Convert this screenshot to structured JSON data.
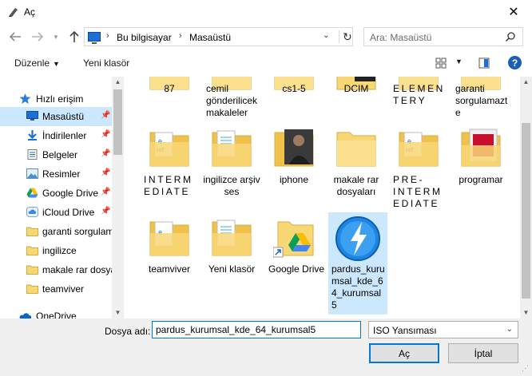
{
  "window": {
    "title": "Aç"
  },
  "address": {
    "segments": [
      "Bu bilgisayar",
      "Masaüstü"
    ]
  },
  "search": {
    "placeholder": "Ara: Masaüstü"
  },
  "toolbar": {
    "organize_label": "Düzenle",
    "new_folder_label": "Yeni klasör"
  },
  "sidebar": {
    "items": [
      {
        "label": "Hızlı erişim",
        "icon": "star-icon",
        "pinned": false
      },
      {
        "label": "Masaüstü",
        "icon": "desktop-icon",
        "pinned": true
      },
      {
        "label": "İndirilenler",
        "icon": "download-icon",
        "pinned": true
      },
      {
        "label": "Belgeler",
        "icon": "documents-icon",
        "pinned": true
      },
      {
        "label": "Resimler",
        "icon": "pictures-icon",
        "pinned": true
      },
      {
        "label": "Google Drive",
        "icon": "google-drive-icon",
        "pinned": true
      },
      {
        "label": "iCloud Drive",
        "icon": "icloud-icon",
        "pinned": true
      },
      {
        "label": "garanti sorgulam",
        "icon": "folder-icon",
        "pinned": false
      },
      {
        "label": "ingilizce",
        "icon": "folder-icon",
        "pinned": false
      },
      {
        "label": "makale rar dosya",
        "icon": "folder-icon",
        "pinned": false
      },
      {
        "label": "teamviver",
        "icon": "folder-icon",
        "pinned": false
      },
      {
        "label": "OneDrive",
        "icon": "onedrive-icon",
        "pinned": false
      }
    ]
  },
  "files": [
    {
      "label": "87",
      "icon": "folder-icon"
    },
    {
      "label": "cemil gönderilicek makaleler",
      "icon": "folder-icon"
    },
    {
      "label": "cs1-5",
      "icon": "folder-icon"
    },
    {
      "label": "DCIM",
      "icon": "folder-icon"
    },
    {
      "label": "ELEMENTERY",
      "icon": "folder-icon"
    },
    {
      "label": "garanti sorgulamazte",
      "icon": "folder-icon"
    },
    {
      "label": "INTERMEDIATE",
      "icon": "folder-icon"
    },
    {
      "label": "ingilizce arşiv ses",
      "icon": "folder-icon"
    },
    {
      "label": "iphone",
      "icon": "folder-icon"
    },
    {
      "label": "makale rar dosyaları",
      "icon": "folder-icon"
    },
    {
      "label": "PRE-INTERMEDIATE",
      "icon": "folder-icon"
    },
    {
      "label": "programar",
      "icon": "folder-icon"
    },
    {
      "label": "teamviver",
      "icon": "folder-icon"
    },
    {
      "label": "Yeni klasör",
      "icon": "folder-icon"
    },
    {
      "label": "Google Drive",
      "icon": "google-drive-shortcut-icon"
    },
    {
      "label": "pardus_kurumsal_kde_64_kurumsal5",
      "icon": "daemon-tools-icon"
    }
  ],
  "filename": {
    "label": "Dosya adı:",
    "value": "pardus_kurumsal_kde_64_kurumsal5"
  },
  "filetype": {
    "selected": "ISO Yansıması"
  },
  "buttons": {
    "open": "Aç",
    "cancel": "İptal"
  },
  "colors": {
    "accent": "#0078d7",
    "selection": "#cce8ff",
    "folder": "#f8d775"
  }
}
